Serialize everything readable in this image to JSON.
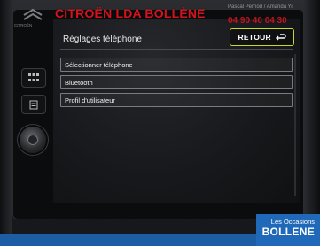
{
  "watermark": {
    "dealer_name": "CITROËN LDA BOLLÈNE",
    "phone": "04 90 40 04 30",
    "small_text": "Pascal Pernod / Amanda Yi",
    "logo_caption": "CITROËN"
  },
  "screen": {
    "title": "Réglages téléphone",
    "back_label": "RETOUR",
    "menu_items": [
      {
        "label": "Sélectionner téléphone"
      },
      {
        "label": "Bluetooth"
      },
      {
        "label": "Profil d'utilisateur"
      }
    ]
  },
  "badge": {
    "line1": "Les Occasions",
    "line2": "BOLLENE"
  },
  "colors": {
    "accent_border": "#c9d72a",
    "watermark_red": "#e0141e",
    "badge_blue": "#1f69b8"
  }
}
